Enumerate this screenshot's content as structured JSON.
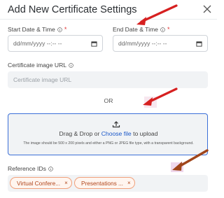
{
  "modal": {
    "title": "Add New Certificate Settings",
    "close_symbol": "×"
  },
  "start_date": {
    "label": "Start Date & Time",
    "required": "*",
    "value": "dd/mm/yyyy --:-- --"
  },
  "end_date": {
    "label": "End Date & Time",
    "required": "*",
    "value": "dd/mm/yyyy --:-- --"
  },
  "certificate_image": {
    "label": "Certificate image URL",
    "placeholder": "Certificate image URL"
  },
  "separator": "OR",
  "dropzone": {
    "text_before": "Drag & Drop or ",
    "link": "Choose file",
    "text_after": " to upload",
    "hint": "The image should be 500 x 200 pixels and either a PNG or JPEG file type, with a transparent background."
  },
  "reference_ids": {
    "label": "Reference IDs",
    "tags": [
      {
        "label": "Virtual Confere...",
        "remove": "×"
      },
      {
        "label": "Presentations ...",
        "remove": "×"
      }
    ]
  },
  "icons": [
    "close-icon",
    "info-icon",
    "calendar-icon",
    "upload-icon",
    "arrow-annotation"
  ],
  "colors": {
    "accent_blue": "#1c58c9",
    "required_red": "#e03131",
    "tag_border": "#f0a07b",
    "tag_text": "#b0461c",
    "annotation_arrow": "#d62020",
    "annotation_arrow_brown": "#a0451a"
  }
}
